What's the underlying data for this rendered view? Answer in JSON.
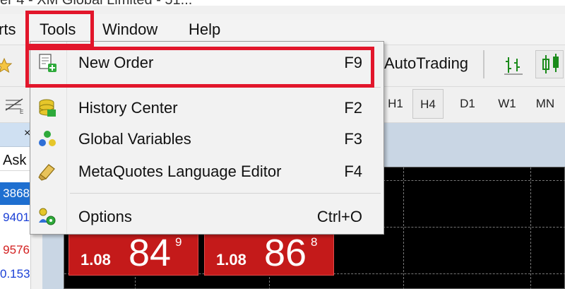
{
  "window": {
    "title": "er 4 - XM Global Limited - 51..."
  },
  "menubar": {
    "items": [
      "rts",
      "Tools",
      "Window",
      "Help"
    ]
  },
  "toolbar": {
    "autotrading_label": "AutoTrading"
  },
  "timeframes": [
    "H1",
    "H4",
    "D1",
    "W1",
    "MN"
  ],
  "timeframes_selected": "H4",
  "market_watch": {
    "ask_header": "Ask",
    "values": [
      {
        "text": "3868",
        "color": "#ffffff",
        "bg": "#1e6fd0"
      },
      {
        "text": "9401",
        "color": "#1a3fd6",
        "bg": "#ffffff"
      },
      {
        "text": "9576",
        "color": "#d32020",
        "bg": "#ffffff"
      },
      {
        "text": "0.153",
        "color": "#1a3fd6",
        "bg": "#ffffff"
      }
    ]
  },
  "tools_menu": {
    "items": [
      {
        "label": "New Order",
        "shortcut": "F9",
        "icon": "new-order-icon"
      },
      {
        "label": "History Center",
        "shortcut": "F2",
        "icon": "history-center-icon"
      },
      {
        "label": "Global Variables",
        "shortcut": "F3",
        "icon": "global-variables-icon"
      },
      {
        "label": "MetaQuotes Language Editor",
        "shortcut": "F4",
        "icon": "metaeditor-icon"
      },
      {
        "label": "Options",
        "shortcut": "Ctrl+O",
        "icon": "options-icon"
      }
    ]
  },
  "one_click": {
    "sell": {
      "prefix": "1.08",
      "big": "84",
      "sup": "9"
    },
    "buy": {
      "prefix": "1.08",
      "big": "86",
      "sup": "8"
    }
  },
  "colors": {
    "highlight": "#e2162b",
    "price_button": "#c41a1a"
  }
}
